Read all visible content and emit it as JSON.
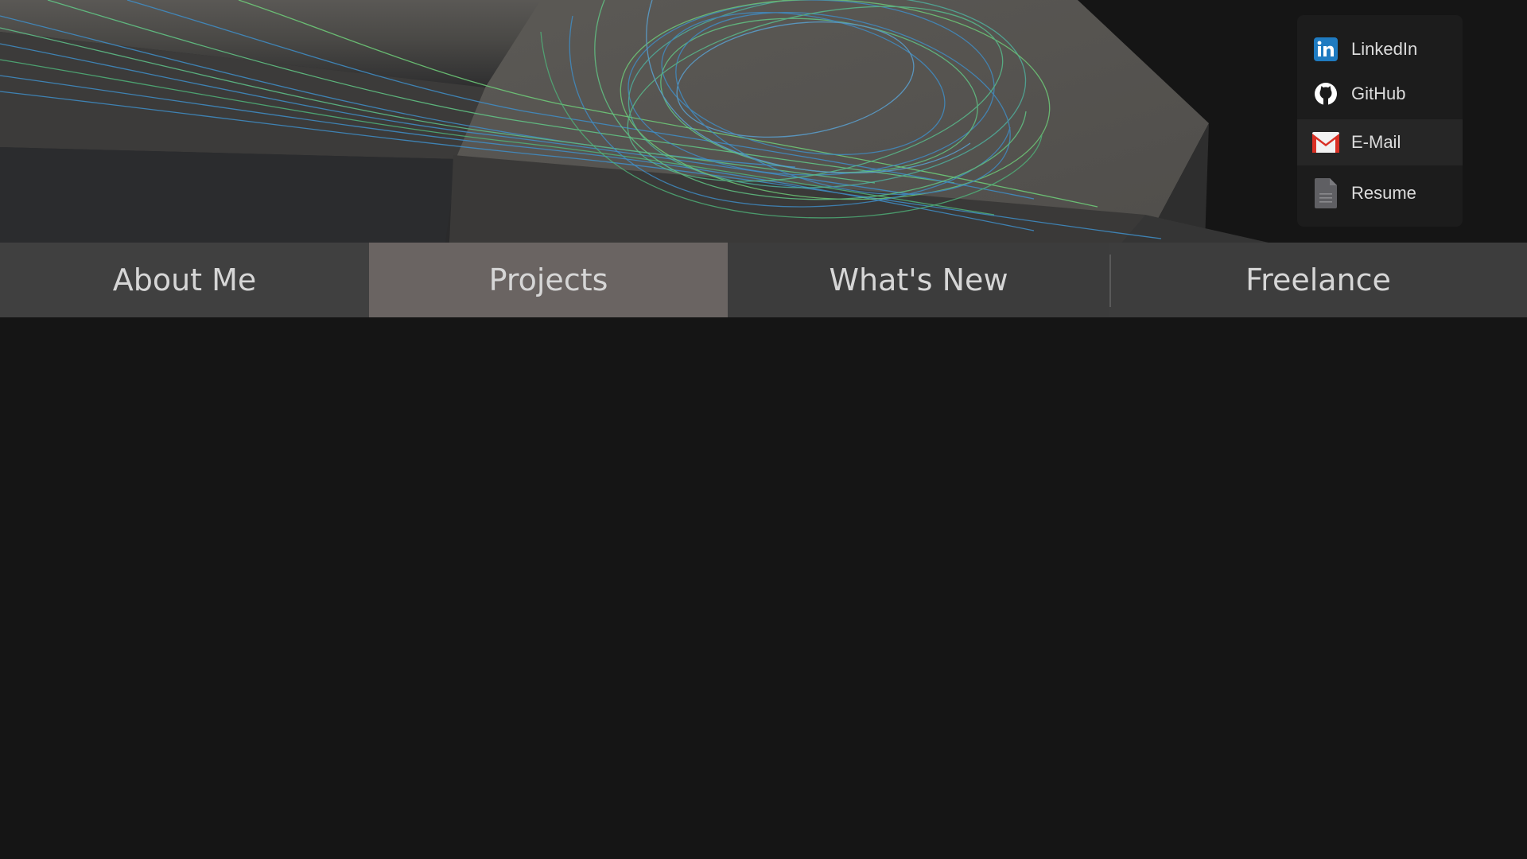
{
  "social": {
    "items": [
      {
        "label": "LinkedIn",
        "icon": "linkedin-icon",
        "color": "#1f7bc1"
      },
      {
        "label": "GitHub",
        "icon": "github-icon",
        "color": "#ffffff"
      },
      {
        "label": "E-Mail",
        "icon": "gmail-icon",
        "color": "#d93025"
      },
      {
        "label": "Resume",
        "icon": "document-icon",
        "color": "#5f5f63"
      }
    ]
  },
  "nav": {
    "tabs": [
      {
        "label": "About Me"
      },
      {
        "label": "Projects",
        "active": true
      },
      {
        "label": "What's New"
      },
      {
        "label": "Freelance"
      }
    ]
  },
  "colors": {
    "background": "#151515",
    "navbar": "#3d3d3d",
    "active_tab": "#6a6462",
    "streamline_green": "#6fcf7a",
    "streamline_blue": "#3f8fc9"
  }
}
